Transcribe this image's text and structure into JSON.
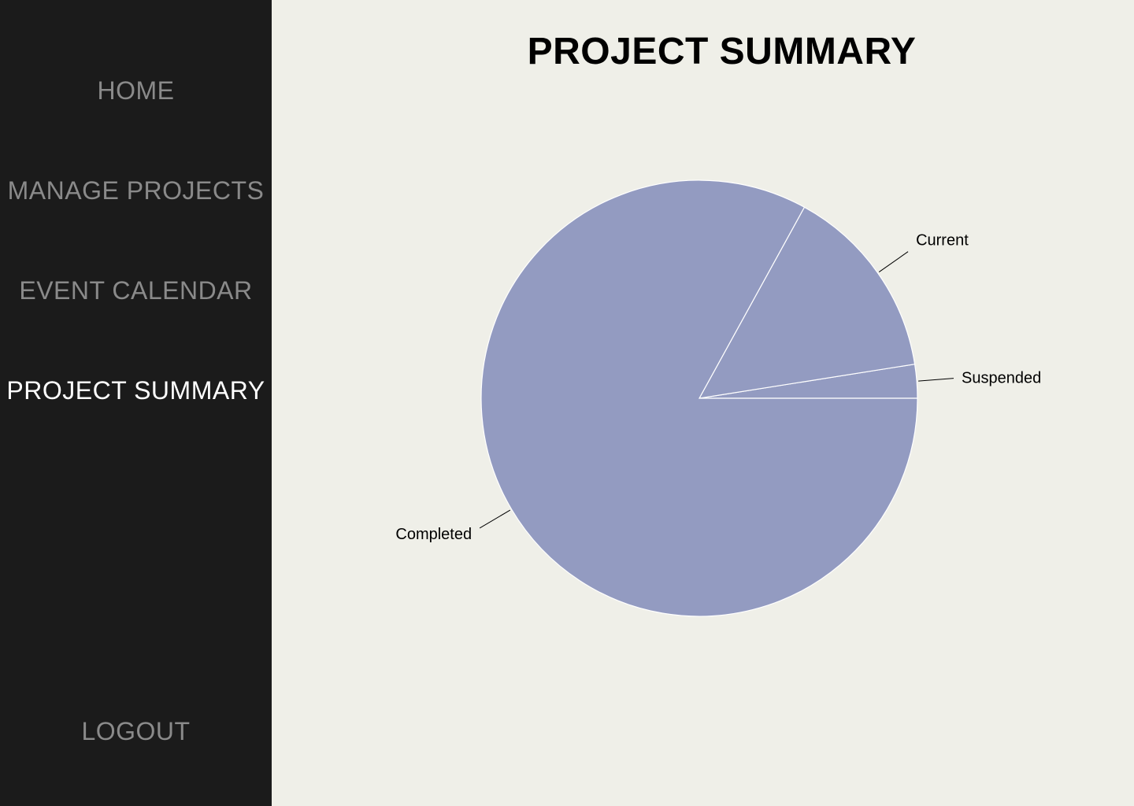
{
  "sidebar": {
    "items": [
      {
        "label": "HOME",
        "active": false
      },
      {
        "label": "MANAGE PROJECTS",
        "active": false
      },
      {
        "label": "EVENT CALENDAR",
        "active": false
      },
      {
        "label": "PROJECT SUMMARY",
        "active": true
      }
    ],
    "logout_label": "LOGOUT",
    "background": "#1b1b1b",
    "inactive_color": "#8a8a8a",
    "active_color": "#ffffff"
  },
  "main": {
    "title": "PROJECT SUMMARY",
    "background": "#efefe8"
  },
  "chart_data": {
    "type": "pie",
    "title": "PROJECT SUMMARY",
    "slices": [
      {
        "label": "Suspended",
        "value": 2.5
      },
      {
        "label": "Current",
        "value": 14.5
      },
      {
        "label": "Completed",
        "value": 83.0
      }
    ],
    "color": "#939bc1",
    "edge_color": "#ffffff"
  }
}
